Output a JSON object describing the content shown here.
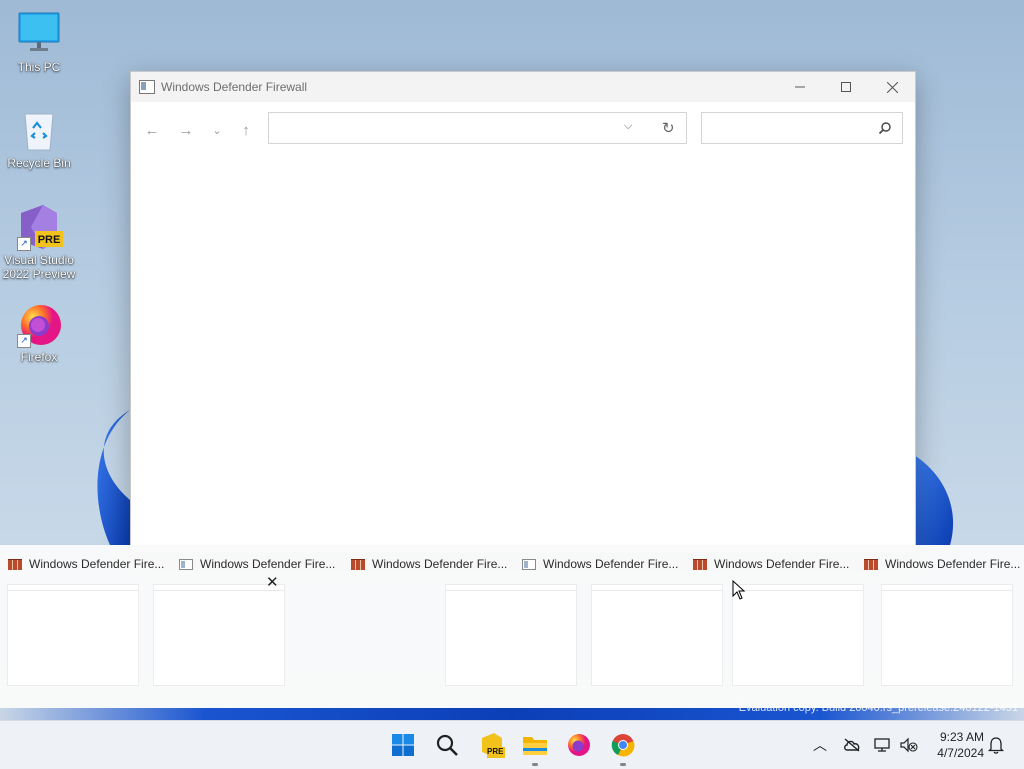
{
  "desktop": {
    "icons": [
      {
        "label": "This PC"
      },
      {
        "label": "Recycle Bin"
      },
      {
        "label": "Visual Studio 2022 Preview",
        "badge": "PRE"
      },
      {
        "label": "Firefox"
      }
    ]
  },
  "window": {
    "title": "Windows Defender Firewall",
    "address_value": "",
    "search_placeholder": ""
  },
  "switcher": {
    "tiles": [
      {
        "title": "Windows Defender Fire...",
        "icon": "firewall-icon"
      },
      {
        "title": "Windows Defender Fire...",
        "icon": "window-icon"
      },
      {
        "title": "Windows Defender Fire...",
        "icon": "firewall-icon"
      },
      {
        "title": "Windows Defender Fire...",
        "icon": "window-icon"
      },
      {
        "title": "Windows Defender Fire...",
        "icon": "firewall-icon"
      },
      {
        "title": "Windows Defender Fire...",
        "icon": "firewall-icon"
      }
    ]
  },
  "watermark": "Evaluation copy. Build 26040.rs_prerelease.240122-1451",
  "taskbar": {
    "apps": [
      "start-icon",
      "search-icon",
      "visual-studio-icon",
      "file-explorer-icon",
      "firefox-icon",
      "chrome-icon"
    ],
    "badge": "PRE"
  },
  "tray": {
    "time": "9:23 AM",
    "date": "4/7/2024"
  },
  "colors": {
    "accent": "#0067c0",
    "taskbar": "#eef2f7",
    "wallpaper_blue": "#1a55d0"
  }
}
